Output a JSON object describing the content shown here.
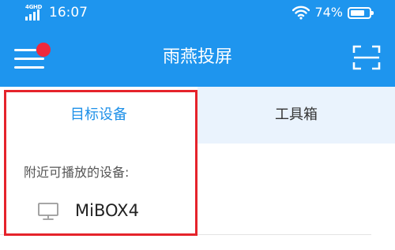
{
  "status_bar": {
    "network": "4GHD",
    "time": "16:07",
    "battery_percent": "74%",
    "battery_level": 0.74,
    "icons": [
      "signal-icon",
      "wifi-icon",
      "battery-icon"
    ]
  },
  "app_bar": {
    "title": "雨燕投屏",
    "menu_icon": "menu-icon",
    "notification_badge": "red-dot",
    "scan_icon": "scan-icon"
  },
  "tabs": [
    {
      "label": "目标设备",
      "selected": true
    },
    {
      "label": "工具箱",
      "selected": false
    }
  ],
  "content": {
    "section_label": "附近可播放的设备:",
    "devices": [
      {
        "name": "MiBOX4",
        "icon": "monitor-icon"
      }
    ]
  },
  "colors": {
    "primary": "#1e95ee",
    "selected_tab_text": "#1e90e8",
    "inactive_tab_bg": "#eaf3fd",
    "badge": "#f0283c",
    "highlight": "#e5232b"
  }
}
